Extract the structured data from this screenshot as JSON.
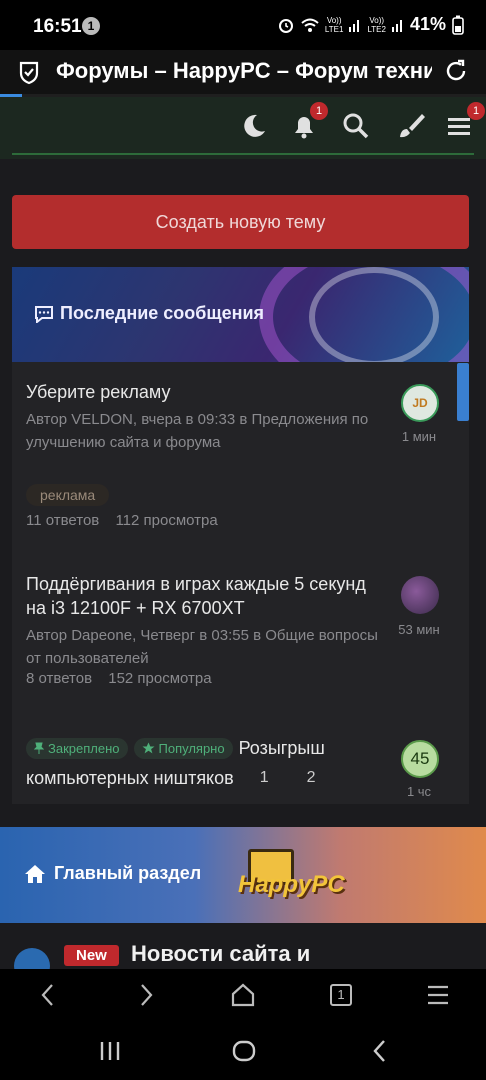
{
  "status_bar": {
    "time": "16:51",
    "notification_count": "1",
    "sim1": "LTE1",
    "sim2": "LTE2",
    "battery": "41%"
  },
  "browser": {
    "page_title": "Форумы – HappyPC – Форум технической поддержки"
  },
  "header": {
    "alerts_badge": "1",
    "menu_badge": "1"
  },
  "create_topic_label": "Создать новую тему",
  "latest": {
    "heading": "Последние сообщения",
    "threads": [
      {
        "title": "Уберите рекламу",
        "meta": "Автор VELDON, вчера в 09:33 в Предложения по улучшению сайта и форума",
        "tag": "реклама",
        "replies": "11 ответов",
        "views": "112 просмотра",
        "ago": "1 мин",
        "avatar_text": "JD"
      },
      {
        "title": "Поддёргивания в играх каждые 5 секунд на i3 12100F + RX 6700XT",
        "meta": "Автор Dapeone, Четверг в 03:55 в Общие вопросы от пользователей",
        "replies": "8 ответов",
        "views": "152 просмотра",
        "ago": "53 мин"
      },
      {
        "pinned": "Закреплено",
        "popular": "Популярно",
        "title_first": "Розыгрыш",
        "title_rest": "компьютерных ништяков",
        "page1": "1",
        "page2": "2",
        "avatar_text": "45",
        "ago": "1 чс"
      }
    ]
  },
  "main_section": {
    "heading": "Главный раздел",
    "logo_text": "HappyPC"
  },
  "news": {
    "badge": "New",
    "title": "Новости сайта и"
  },
  "nav": {
    "tabs_count": "1"
  },
  "colors": {
    "create_button": "#b32d2d",
    "accent_blue": "#3a7fd0",
    "badge_red": "#c0292d"
  }
}
